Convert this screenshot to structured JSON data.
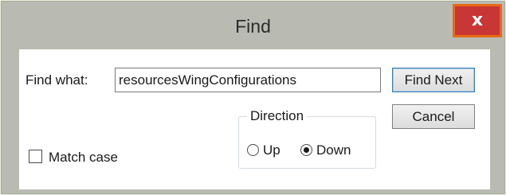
{
  "window": {
    "title": "Find",
    "close_glyph": "x"
  },
  "find": {
    "label": "Find what:",
    "value": "resourcesWingConfigurations"
  },
  "buttons": {
    "find_next": "Find Next",
    "cancel": "Cancel"
  },
  "options": {
    "match_case_label": "Match case",
    "match_case_checked": false
  },
  "direction": {
    "title": "Direction",
    "up_label": "Up",
    "down_label": "Down",
    "selected": "Down"
  },
  "colors": {
    "close_button": "#c83636",
    "close_highlight": "#e86a16",
    "titlebar": "#b9bbb3",
    "outer_background": "#eef2df"
  }
}
